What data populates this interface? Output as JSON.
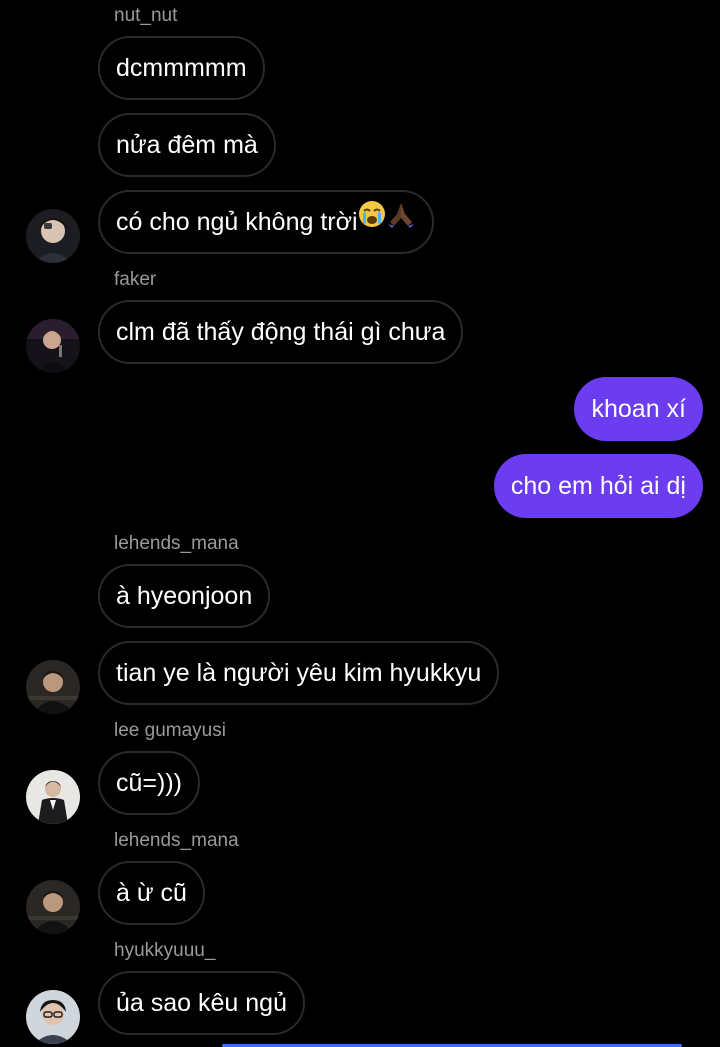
{
  "colors": {
    "background": "#000000",
    "outgoing_bubble": "#6b3cf0",
    "incoming_border": "#2a2a2e",
    "sender_name": "#9a9a9a"
  },
  "messages": {
    "m1": {
      "sender": "nut_nut",
      "text": "dcmmmmm"
    },
    "m2": {
      "text": "nửa đêm mà"
    },
    "m3": {
      "text": "có cho ngủ không trời",
      "emoji": "crying-face, folded-hands"
    },
    "m4": {
      "sender": "faker",
      "text": "clm đã thấy động thái gì chưa"
    },
    "m5": {
      "text": "khoan xí"
    },
    "m6": {
      "text": "cho em hỏi ai dị"
    },
    "m7": {
      "sender": "lehends_mana",
      "text": "à hyeonjoon"
    },
    "m8": {
      "text": "tian ye là người yêu kim hyukkyu"
    },
    "m9": {
      "sender": "lee gumayusi",
      "text": "cũ=)))"
    },
    "m10": {
      "sender": "lehends_mana",
      "text": "à ừ cũ"
    },
    "m11": {
      "sender": "hyukkyuuu_",
      "text": "ủa sao kêu ngủ"
    }
  },
  "icons": {
    "avatar_nut_nut": "avatar-photo",
    "avatar_faker": "avatar-photo",
    "avatar_lehends_mana": "avatar-photo",
    "avatar_lee_gumayusi": "avatar-photo",
    "avatar_hyukkyuuu": "avatar-photo"
  }
}
